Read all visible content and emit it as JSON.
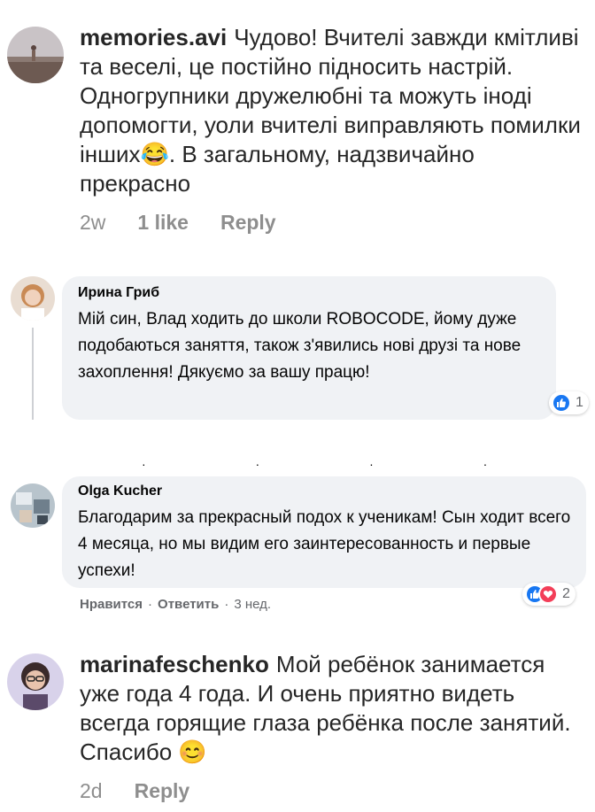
{
  "comments_top": {
    "username": "memories.avi",
    "text": "Чудово! Вчителі завжди кмітливі та веселі, це постійно підносить настрій. Одногрупники дружелюбні та можуть іноді допомогти, уоли вчителі виправляють помилки інших😂. В загальному, надзвичайно прекрасно",
    "time": "2w",
    "likes": "1 like",
    "reply": "Reply"
  },
  "fb_comment_1": {
    "name": "Ирина Гриб",
    "text": "Мій син, Влад ходить до школи ROBOCODE, йому дуже подобаються заняття, також з'явились нові друзі та нове захоплення! Дякуємо за вашу працю!",
    "reaction_count": "1"
  },
  "fb_comment_2": {
    "name": "Olga Kucher",
    "text": "Благодарим за прекрасный подох к ученикам! Сын ходит всего 4 месяца, но мы видим его заинтересованность и первые успехи!",
    "reaction_count": "2",
    "like_action": "Нравится",
    "separator": "·",
    "reply_action": "Ответить",
    "time": "3 нед."
  },
  "comments_bottom": {
    "username": "marinafeschenko",
    "text": "Мой ребёнок занимается уже года 4 года. И очень приятно видеть всегда горящие глаза ребёнка после занятий. Спасибо 😊",
    "time": "2d",
    "reply": "Reply"
  },
  "colors": {
    "fb_like": "#1877f2",
    "fb_love": "#f33e58",
    "bubble_bg": "#f0f2f5",
    "meta_gray": "#8e8e8e"
  }
}
